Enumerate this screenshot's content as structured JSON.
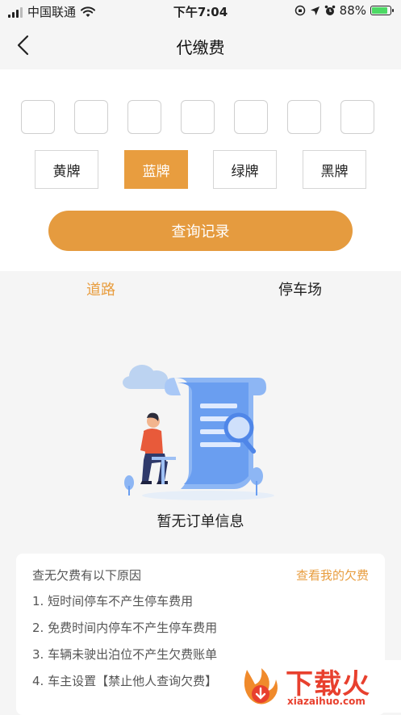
{
  "status_bar": {
    "carrier": "中国联通",
    "time": "下午7:04",
    "battery": "88%",
    "battery_level": 0.88,
    "icons": [
      "signal-icon",
      "wifi-icon",
      "rotation-lock-icon",
      "location-icon",
      "alarm-icon",
      "battery-icon"
    ]
  },
  "nav": {
    "title": "代缴费",
    "back_icon": "chevron-left-icon"
  },
  "plate": {
    "boxes": [
      "",
      "",
      "",
      "",
      "",
      "",
      ""
    ],
    "colors": [
      "黄牌",
      "蓝牌",
      "绿牌",
      "黑牌"
    ],
    "selected_color": "蓝牌",
    "query_label": "查询记录"
  },
  "tabs": {
    "road": "道路",
    "parking": "停车场",
    "active": "道路"
  },
  "empty_state": {
    "text": "暂无订单信息",
    "icon": "empty-orders-illustration"
  },
  "reasons": {
    "title": "查无欠费有以下原因",
    "link": "查看我的欠费",
    "items": [
      "1. 短时间停车不产生停车费用",
      "2. 免费时间内停车不产生停车费用",
      "3. 车辆未驶出泊位不产生欠费账单",
      "4. 车主设置【禁止他人查询欠费】"
    ]
  },
  "watermark": {
    "text": "下载火",
    "url": "xiazaihuo.com"
  },
  "colors": {
    "accent": "#E89D3F",
    "watermark": "#E8402E"
  }
}
